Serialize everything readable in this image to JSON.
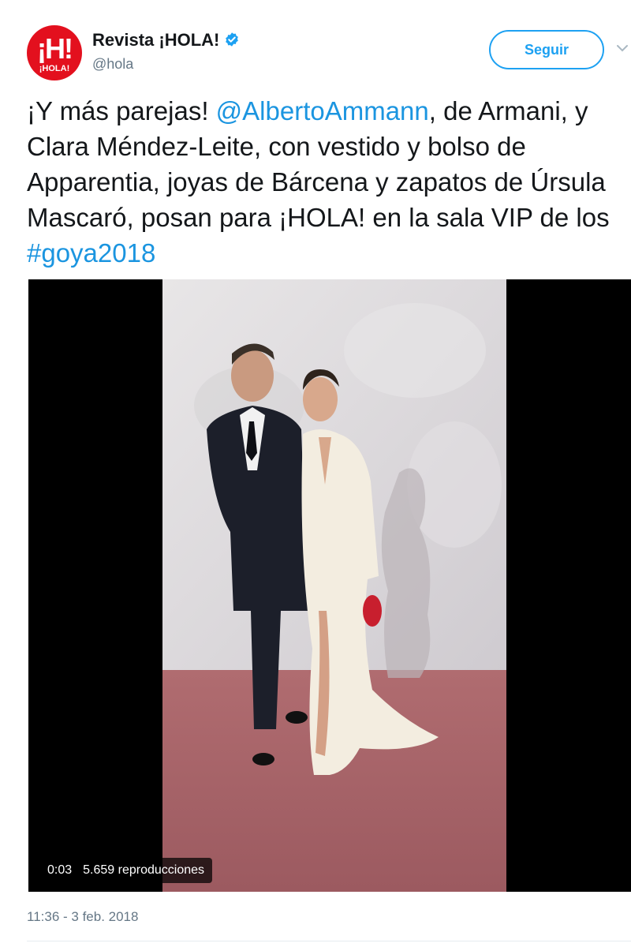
{
  "header": {
    "display_name": "Revista ¡HOLA!",
    "handle": "@hola",
    "follow_label": "Seguir",
    "avatar_mark": "¡H!",
    "avatar_word": "¡HOLA!",
    "verified_icon": "verified-badge-icon",
    "menu_icon": "chevron-down-icon"
  },
  "tweet": {
    "text_1": "¡Y más parejas! ",
    "mention": "@AlbertoAmmann",
    "text_2": ", de Armani, y Clara Méndez-Leite, con vestido y bolso de Apparentia, joyas de Bárcena y zapatos de Úrsula Mascaró, posan para ¡HOLA! en la sala VIP de los ",
    "hashtag": "#goya2018"
  },
  "video": {
    "elapsed": "0:03",
    "views": "5.659 reproducciones"
  },
  "timestamp": "11:36 - 3 feb. 2018",
  "colors": {
    "accent": "#1da1f2",
    "link": "#1b95e0",
    "brand_red": "#e3101e"
  }
}
